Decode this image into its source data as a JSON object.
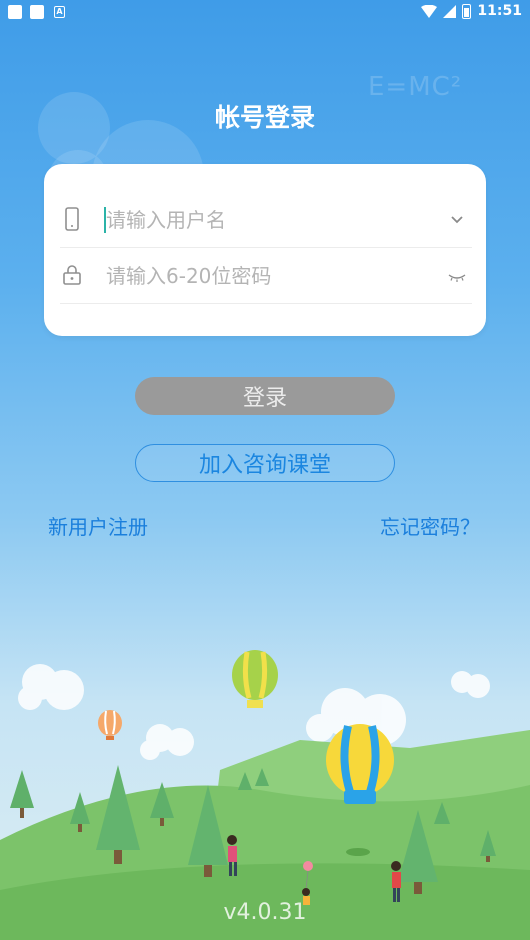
{
  "status_bar": {
    "time": "11:51"
  },
  "header": {
    "title": "帐号登录",
    "decoration_text": "E=MC²"
  },
  "form": {
    "username": {
      "placeholder": "请输入用户名",
      "value": ""
    },
    "password": {
      "placeholder": "请输入6-20位密码",
      "value": ""
    }
  },
  "buttons": {
    "login": "登录",
    "join": "加入咨询课堂"
  },
  "links": {
    "register": "新用户注册",
    "forgot": "忘记密码？"
  },
  "footer": {
    "version": "v4.0.31"
  },
  "colors": {
    "sky_top": "#3f9ce8",
    "accent_blue": "#1b7fdc",
    "login_disabled": "#9a9a9a",
    "hill_green": "#7cc36a"
  },
  "icons": {
    "username": "phone-icon",
    "password": "lock-icon",
    "dropdown": "chevron-down-icon",
    "password_toggle": "eye-closed-icon"
  }
}
